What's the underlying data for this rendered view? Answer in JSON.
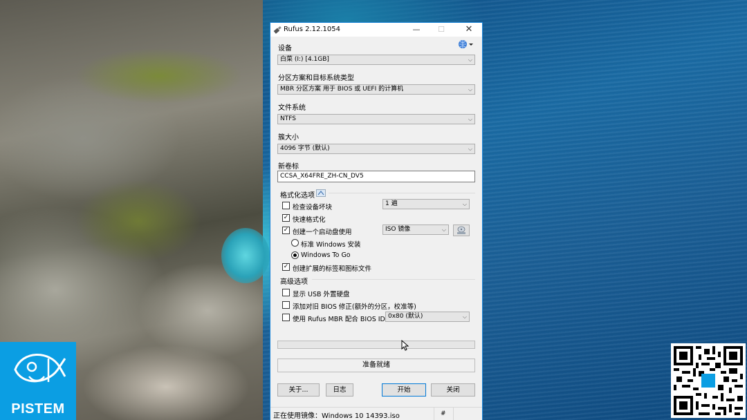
{
  "window": {
    "title": "Rufus 2.12.1054",
    "minimize_glyph": "—",
    "maximize_glyph": "☐",
    "close_glyph": "✕",
    "language_icon": "globe-dropdown-icon"
  },
  "device": {
    "label": "设备",
    "value": "白菜 (I:) [4.1GB]"
  },
  "partition": {
    "label": "分区方案和目标系统类型",
    "value": "MBR 分区方案 用于 BIOS 或 UEFI 的计算机"
  },
  "filesystem": {
    "label": "文件系统",
    "value": "NTFS"
  },
  "cluster": {
    "label": "簇大小",
    "value": "4096 字节 (默认)"
  },
  "volume": {
    "label": "新卷标",
    "value": "CCSA_X64FRE_ZH-CN_DV5"
  },
  "format_options": {
    "heading": "格式化选项",
    "check_bad_blocks": {
      "label": "检查设备坏块",
      "checked": false
    },
    "passes": "1 遍",
    "quick_format": {
      "label": "快速格式化",
      "checked": true
    },
    "bootable": {
      "label": "创建一个启动盘使用",
      "checked": true
    },
    "boot_type": "ISO 镜像",
    "standard_windows": {
      "label": "标准 Windows 安装",
      "selected": false
    },
    "windows_to_go": {
      "label": "Windows To Go",
      "selected": true
    },
    "extended_label": {
      "label": "创建扩展的标签和图标文件",
      "checked": true
    }
  },
  "advanced": {
    "heading": "高级选项",
    "usb_hdd": {
      "label": "显示 USB 外置硬盘",
      "checked": false
    },
    "old_bios": {
      "label": "添加对旧 BIOS 修正(额外的分区，校准等)",
      "checked": false
    },
    "rufus_mbr": {
      "label": "使用 Rufus MBR 配合 BIOS ID",
      "checked": false
    },
    "bios_id": "0x80 (默认)"
  },
  "progress": {
    "percent": 0
  },
  "status": "准备就绪",
  "buttons": {
    "about": "关于...",
    "log": "日志",
    "start": "开始",
    "close": "关闭"
  },
  "statusbar": {
    "message": "正在使用镜像：Windows 10 14393.iso",
    "hash": "#"
  },
  "logo": {
    "text": "PISTEM"
  },
  "colors": {
    "window_border": "#1883d7",
    "logo_bg": "#0b9ee3",
    "progress_fill": "#06b025"
  }
}
